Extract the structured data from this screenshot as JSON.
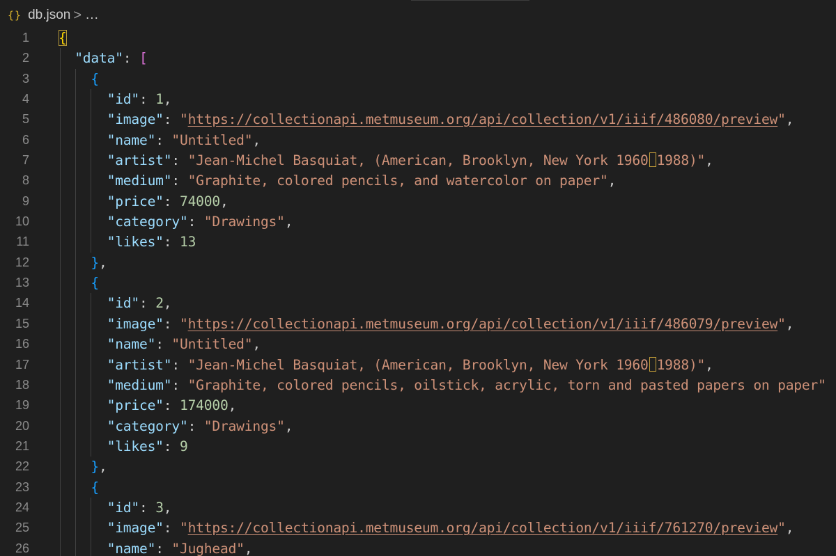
{
  "breadcrumb": {
    "icon": "{}",
    "file_name": "db.json",
    "separator": ">",
    "more": "..."
  },
  "editor": {
    "lines": [
      {
        "number": "1",
        "indent": 0,
        "tokens": [
          {
            "t": "{",
            "c": "b1 hl"
          }
        ]
      },
      {
        "number": "2",
        "indent": 1,
        "tokens": [
          {
            "t": "\"data\"",
            "c": "k"
          },
          {
            "t": ": ",
            "c": "p"
          },
          {
            "t": "[",
            "c": "b2"
          }
        ]
      },
      {
        "number": "3",
        "indent": 2,
        "tokens": [
          {
            "t": "{",
            "c": "b3"
          }
        ]
      },
      {
        "number": "4",
        "indent": 3,
        "tokens": [
          {
            "t": "\"id\"",
            "c": "k"
          },
          {
            "t": ": ",
            "c": "p"
          },
          {
            "t": "1",
            "c": "n"
          },
          {
            "t": ",",
            "c": "p"
          }
        ]
      },
      {
        "number": "5",
        "indent": 3,
        "tokens": [
          {
            "t": "\"image\"",
            "c": "k"
          },
          {
            "t": ": ",
            "c": "p"
          },
          {
            "t": "\"",
            "c": "s"
          },
          {
            "t": "https://collectionapi.metmuseum.org/api/collection/v1/iiif/486080/preview",
            "c": "s url"
          },
          {
            "t": "\"",
            "c": "s"
          },
          {
            "t": ",",
            "c": "p"
          }
        ]
      },
      {
        "number": "6",
        "indent": 3,
        "tokens": [
          {
            "t": "\"name\"",
            "c": "k"
          },
          {
            "t": ": ",
            "c": "p"
          },
          {
            "t": "\"Untitled\"",
            "c": "s"
          },
          {
            "t": ",",
            "c": "p"
          }
        ]
      },
      {
        "number": "7",
        "indent": 3,
        "tokens": [
          {
            "t": "\"artist\"",
            "c": "k"
          },
          {
            "t": ": ",
            "c": "p"
          },
          {
            "t": "\"Jean-Michel Basquiat, (American, Brooklyn, New York 1960",
            "c": "s"
          },
          {
            "t": "",
            "c": "uc"
          },
          {
            "t": "1988)\"",
            "c": "s"
          },
          {
            "t": ",",
            "c": "p"
          }
        ]
      },
      {
        "number": "8",
        "indent": 3,
        "tokens": [
          {
            "t": "\"medium\"",
            "c": "k"
          },
          {
            "t": ": ",
            "c": "p"
          },
          {
            "t": "\"Graphite, colored pencils, and watercolor on paper\"",
            "c": "s"
          },
          {
            "t": ",",
            "c": "p"
          }
        ]
      },
      {
        "number": "9",
        "indent": 3,
        "tokens": [
          {
            "t": "\"price\"",
            "c": "k"
          },
          {
            "t": ": ",
            "c": "p"
          },
          {
            "t": "74000",
            "c": "n"
          },
          {
            "t": ",",
            "c": "p"
          }
        ]
      },
      {
        "number": "10",
        "indent": 3,
        "tokens": [
          {
            "t": "\"category\"",
            "c": "k"
          },
          {
            "t": ": ",
            "c": "p"
          },
          {
            "t": "\"Drawings\"",
            "c": "s"
          },
          {
            "t": ",",
            "c": "p"
          }
        ]
      },
      {
        "number": "11",
        "indent": 3,
        "tokens": [
          {
            "t": "\"likes\"",
            "c": "k"
          },
          {
            "t": ": ",
            "c": "p"
          },
          {
            "t": "13",
            "c": "n"
          }
        ]
      },
      {
        "number": "12",
        "indent": 2,
        "tokens": [
          {
            "t": "}",
            "c": "b3"
          },
          {
            "t": ",",
            "c": "p"
          }
        ]
      },
      {
        "number": "13",
        "indent": 2,
        "tokens": [
          {
            "t": "{",
            "c": "b3"
          }
        ]
      },
      {
        "number": "14",
        "indent": 3,
        "tokens": [
          {
            "t": "\"id\"",
            "c": "k"
          },
          {
            "t": ": ",
            "c": "p"
          },
          {
            "t": "2",
            "c": "n"
          },
          {
            "t": ",",
            "c": "p"
          }
        ]
      },
      {
        "number": "15",
        "indent": 3,
        "tokens": [
          {
            "t": "\"image\"",
            "c": "k"
          },
          {
            "t": ": ",
            "c": "p"
          },
          {
            "t": "\"",
            "c": "s"
          },
          {
            "t": "https://collectionapi.metmuseum.org/api/collection/v1/iiif/486079/preview",
            "c": "s url"
          },
          {
            "t": "\"",
            "c": "s"
          },
          {
            "t": ",",
            "c": "p"
          }
        ]
      },
      {
        "number": "16",
        "indent": 3,
        "tokens": [
          {
            "t": "\"name\"",
            "c": "k"
          },
          {
            "t": ": ",
            "c": "p"
          },
          {
            "t": "\"Untitled\"",
            "c": "s"
          },
          {
            "t": ",",
            "c": "p"
          }
        ]
      },
      {
        "number": "17",
        "indent": 3,
        "tokens": [
          {
            "t": "\"artist\"",
            "c": "k"
          },
          {
            "t": ": ",
            "c": "p"
          },
          {
            "t": "\"Jean-Michel Basquiat, (American, Brooklyn, New York 1960",
            "c": "s"
          },
          {
            "t": "",
            "c": "uc"
          },
          {
            "t": "1988)\"",
            "c": "s"
          },
          {
            "t": ",",
            "c": "p"
          }
        ]
      },
      {
        "number": "18",
        "indent": 3,
        "tokens": [
          {
            "t": "\"medium\"",
            "c": "k"
          },
          {
            "t": ": ",
            "c": "p"
          },
          {
            "t": "\"Graphite, colored pencils, oilstick, acrylic, torn and pasted papers on paper\"",
            "c": "s"
          }
        ]
      },
      {
        "number": "19",
        "indent": 3,
        "tokens": [
          {
            "t": "\"price\"",
            "c": "k"
          },
          {
            "t": ": ",
            "c": "p"
          },
          {
            "t": "174000",
            "c": "n"
          },
          {
            "t": ",",
            "c": "p"
          }
        ]
      },
      {
        "number": "20",
        "indent": 3,
        "tokens": [
          {
            "t": "\"category\"",
            "c": "k"
          },
          {
            "t": ": ",
            "c": "p"
          },
          {
            "t": "\"Drawings\"",
            "c": "s"
          },
          {
            "t": ",",
            "c": "p"
          }
        ]
      },
      {
        "number": "21",
        "indent": 3,
        "tokens": [
          {
            "t": "\"likes\"",
            "c": "k"
          },
          {
            "t": ": ",
            "c": "p"
          },
          {
            "t": "9",
            "c": "n"
          }
        ]
      },
      {
        "number": "22",
        "indent": 2,
        "tokens": [
          {
            "t": "}",
            "c": "b3"
          },
          {
            "t": ",",
            "c": "p"
          }
        ]
      },
      {
        "number": "23",
        "indent": 2,
        "tokens": [
          {
            "t": "{",
            "c": "b3"
          }
        ]
      },
      {
        "number": "24",
        "indent": 3,
        "tokens": [
          {
            "t": "\"id\"",
            "c": "k"
          },
          {
            "t": ": ",
            "c": "p"
          },
          {
            "t": "3",
            "c": "n"
          },
          {
            "t": ",",
            "c": "p"
          }
        ]
      },
      {
        "number": "25",
        "indent": 3,
        "tokens": [
          {
            "t": "\"image\"",
            "c": "k"
          },
          {
            "t": ": ",
            "c": "p"
          },
          {
            "t": "\"",
            "c": "s"
          },
          {
            "t": "https://collectionapi.metmuseum.org/api/collection/v1/iiif/761270/preview",
            "c": "s url"
          },
          {
            "t": "\"",
            "c": "s"
          },
          {
            "t": ",",
            "c": "p"
          }
        ]
      },
      {
        "number": "26",
        "indent": 3,
        "tokens": [
          {
            "t": "\"name\"",
            "c": "k"
          },
          {
            "t": ": ",
            "c": "p"
          },
          {
            "t": "\"Jughead\"",
            "c": "s"
          },
          {
            "t": ",",
            "c": "p"
          }
        ]
      }
    ]
  }
}
